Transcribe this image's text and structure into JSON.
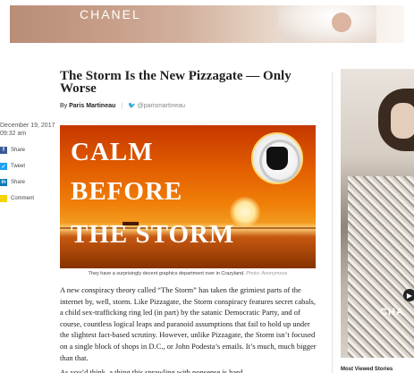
{
  "top_ad": {
    "brand": "CHANEL"
  },
  "article": {
    "headline": "The Storm Is the New Pizzagate — Only Worse",
    "byline_prefix": "By",
    "author": "Paris Martineau",
    "twitter_handle": "@parismartineau",
    "date_line1": "December 19, 2017",
    "date_line2": "09:32 am",
    "hero_lines": [
      "CALM",
      "BEFORE",
      "THE STORM"
    ],
    "caption": "They have a surprisingly decent graphics department over in Crazyland.",
    "caption_credit": "Photo: Anonymous",
    "body_paragraph": "A new conspiracy theory called “The Storm” has taken the grimiest parts of the internet by, well, storm. Like Pizzagate, the Storm conspiracy features secret cabals, a child sex-trafficking ring led (in part) by the satanic Democratic Party, and of course, countless logical leaps and paranoid assumptions that fail to hold up under the slightest fact-based scrutiny. However, unlike Pizzagate, the Storm isn’t focused on a single block of shops in D.C., or John Podesta’s emails. It’s much, much bigger than that.",
    "body_paragraph_2": "As you’d think, a thing this sprawling with nonsense is hard"
  },
  "share": {
    "items": [
      {
        "label": "Share",
        "icon": "facebook-icon"
      },
      {
        "label": "Tweet",
        "icon": "twitter-icon"
      },
      {
        "label": "Share",
        "icon": "linkedin-icon"
      },
      {
        "label": "Comment",
        "icon": "comment-icon"
      }
    ]
  },
  "sidebar": {
    "ad_brand": "CHA",
    "most_viewed_label": "Most Viewed Stories"
  },
  "colors": {
    "facebook": "#3b5998",
    "twitter": "#1da1f2",
    "linkedin": "#0077b5",
    "comment": "#f6d200"
  }
}
